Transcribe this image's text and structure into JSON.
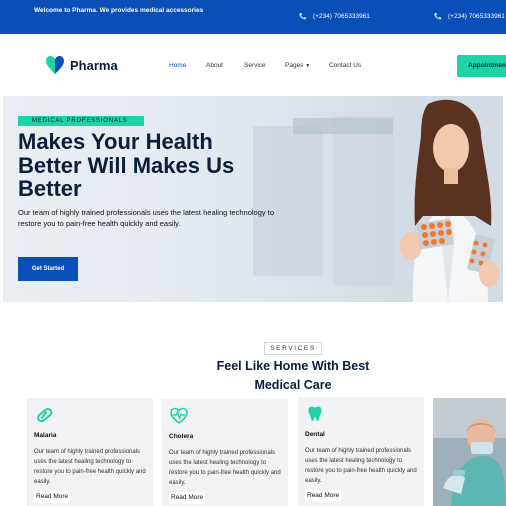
{
  "topbar": {
    "welcome": "Welcome to Pharma. We provides medical accessories",
    "phone_1": "(+234) 7065333961",
    "phone_2": "(+234) 7065333961"
  },
  "header": {
    "brand": "Pharma",
    "nav": [
      "Home",
      "About",
      "Service",
      "Pages",
      "Contact Us"
    ],
    "appointment_label": "Appointment"
  },
  "hero": {
    "tag": "MEDICAL PROFESSIONALS",
    "title_line_1": "Makes Your Health",
    "title_line_2": "Better Will Makes Us",
    "title_line_3": "Better",
    "description": "Our team of highly trained professionals uses the latest healing technology to restore you to pain-free health quickly and easily.",
    "cta": "Get Started"
  },
  "services": {
    "label": "SERVICES",
    "title_line_1": "Feel Like Home With Best",
    "title_line_2": "Medical Care",
    "cards": [
      {
        "name": "Malaria",
        "icon": "pill-icon",
        "text": "Our team of highly trained professionals uses the latest healing technology to restore you to pain-free health quickly and easily.",
        "more": "Read More"
      },
      {
        "name": "Cholera",
        "icon": "heartbeat-icon",
        "text": "Our team of highly trained professionals uses the latest healing technology to restore you to pain-free health quickly and easily.",
        "more": "Read More"
      },
      {
        "name": "Dental",
        "icon": "tooth-icon",
        "text": "Our team of highly trained professionals uses the latest healing technology to restore you to pain-free health quickly and easily.",
        "more": "Read More"
      }
    ]
  },
  "colors": {
    "primary": "#0a4fb8",
    "accent": "#1fd3a6",
    "heading": "#0b1e3a"
  }
}
